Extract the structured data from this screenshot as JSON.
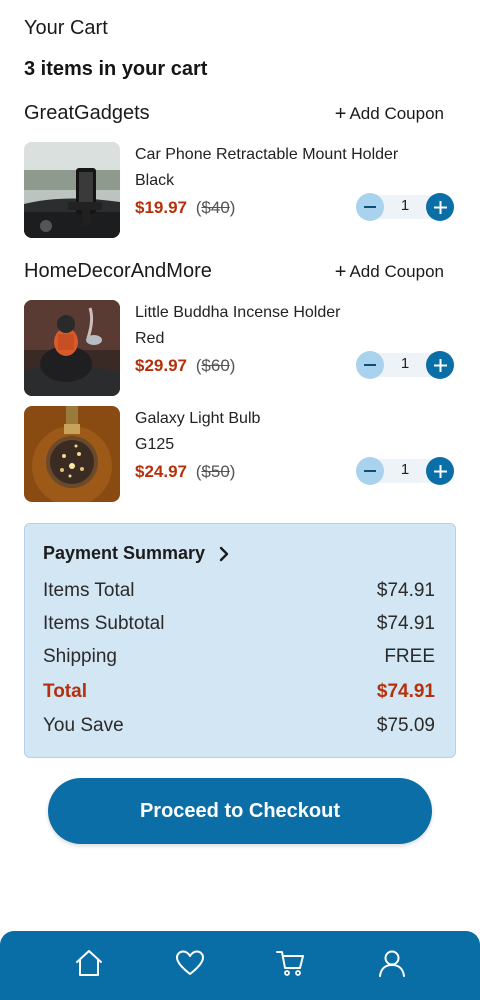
{
  "header": {
    "title": "Your Cart",
    "count_text": "3 items in your cart"
  },
  "stores": [
    {
      "name": "GreatGadgets",
      "coupon_label": "Add Coupon",
      "items": [
        {
          "name": "Car Phone Retractable Mount Holder",
          "variant": "Black",
          "price": "$19.97",
          "original_price": "$40",
          "qty": "1",
          "image": "phone-mount-photo"
        }
      ]
    },
    {
      "name": "HomeDecorAndMore",
      "coupon_label": "Add Coupon",
      "items": [
        {
          "name": "Little Buddha Incense Holder",
          "variant": "Red",
          "price": "$29.97",
          "original_price": "$60",
          "qty": "1",
          "image": "buddha-incense-photo"
        },
        {
          "name": "Galaxy Light Bulb",
          "variant": "G125",
          "price": "$24.97",
          "original_price": "$50",
          "qty": "1",
          "image": "galaxy-bulb-photo"
        }
      ]
    }
  ],
  "summary": {
    "title": "Payment Summary",
    "rows": [
      {
        "label": "Items Total",
        "value": "$74.91"
      },
      {
        "label": "Items Subtotal",
        "value": "$74.91"
      },
      {
        "label": "Shipping",
        "value": "FREE"
      }
    ],
    "total": {
      "label": "Total",
      "value": "$74.91"
    },
    "save": {
      "label": "You Save",
      "value": "$75.09"
    }
  },
  "checkout_label": "Proceed to Checkout",
  "nav": {
    "items": [
      "home-icon",
      "heart-icon",
      "cart-icon",
      "profile-icon"
    ]
  },
  "colors": {
    "accent": "#0a6ea6",
    "price": "#b5300b",
    "summary_bg": "#d3e6f4",
    "minus_btn": "#a9d2ee"
  }
}
